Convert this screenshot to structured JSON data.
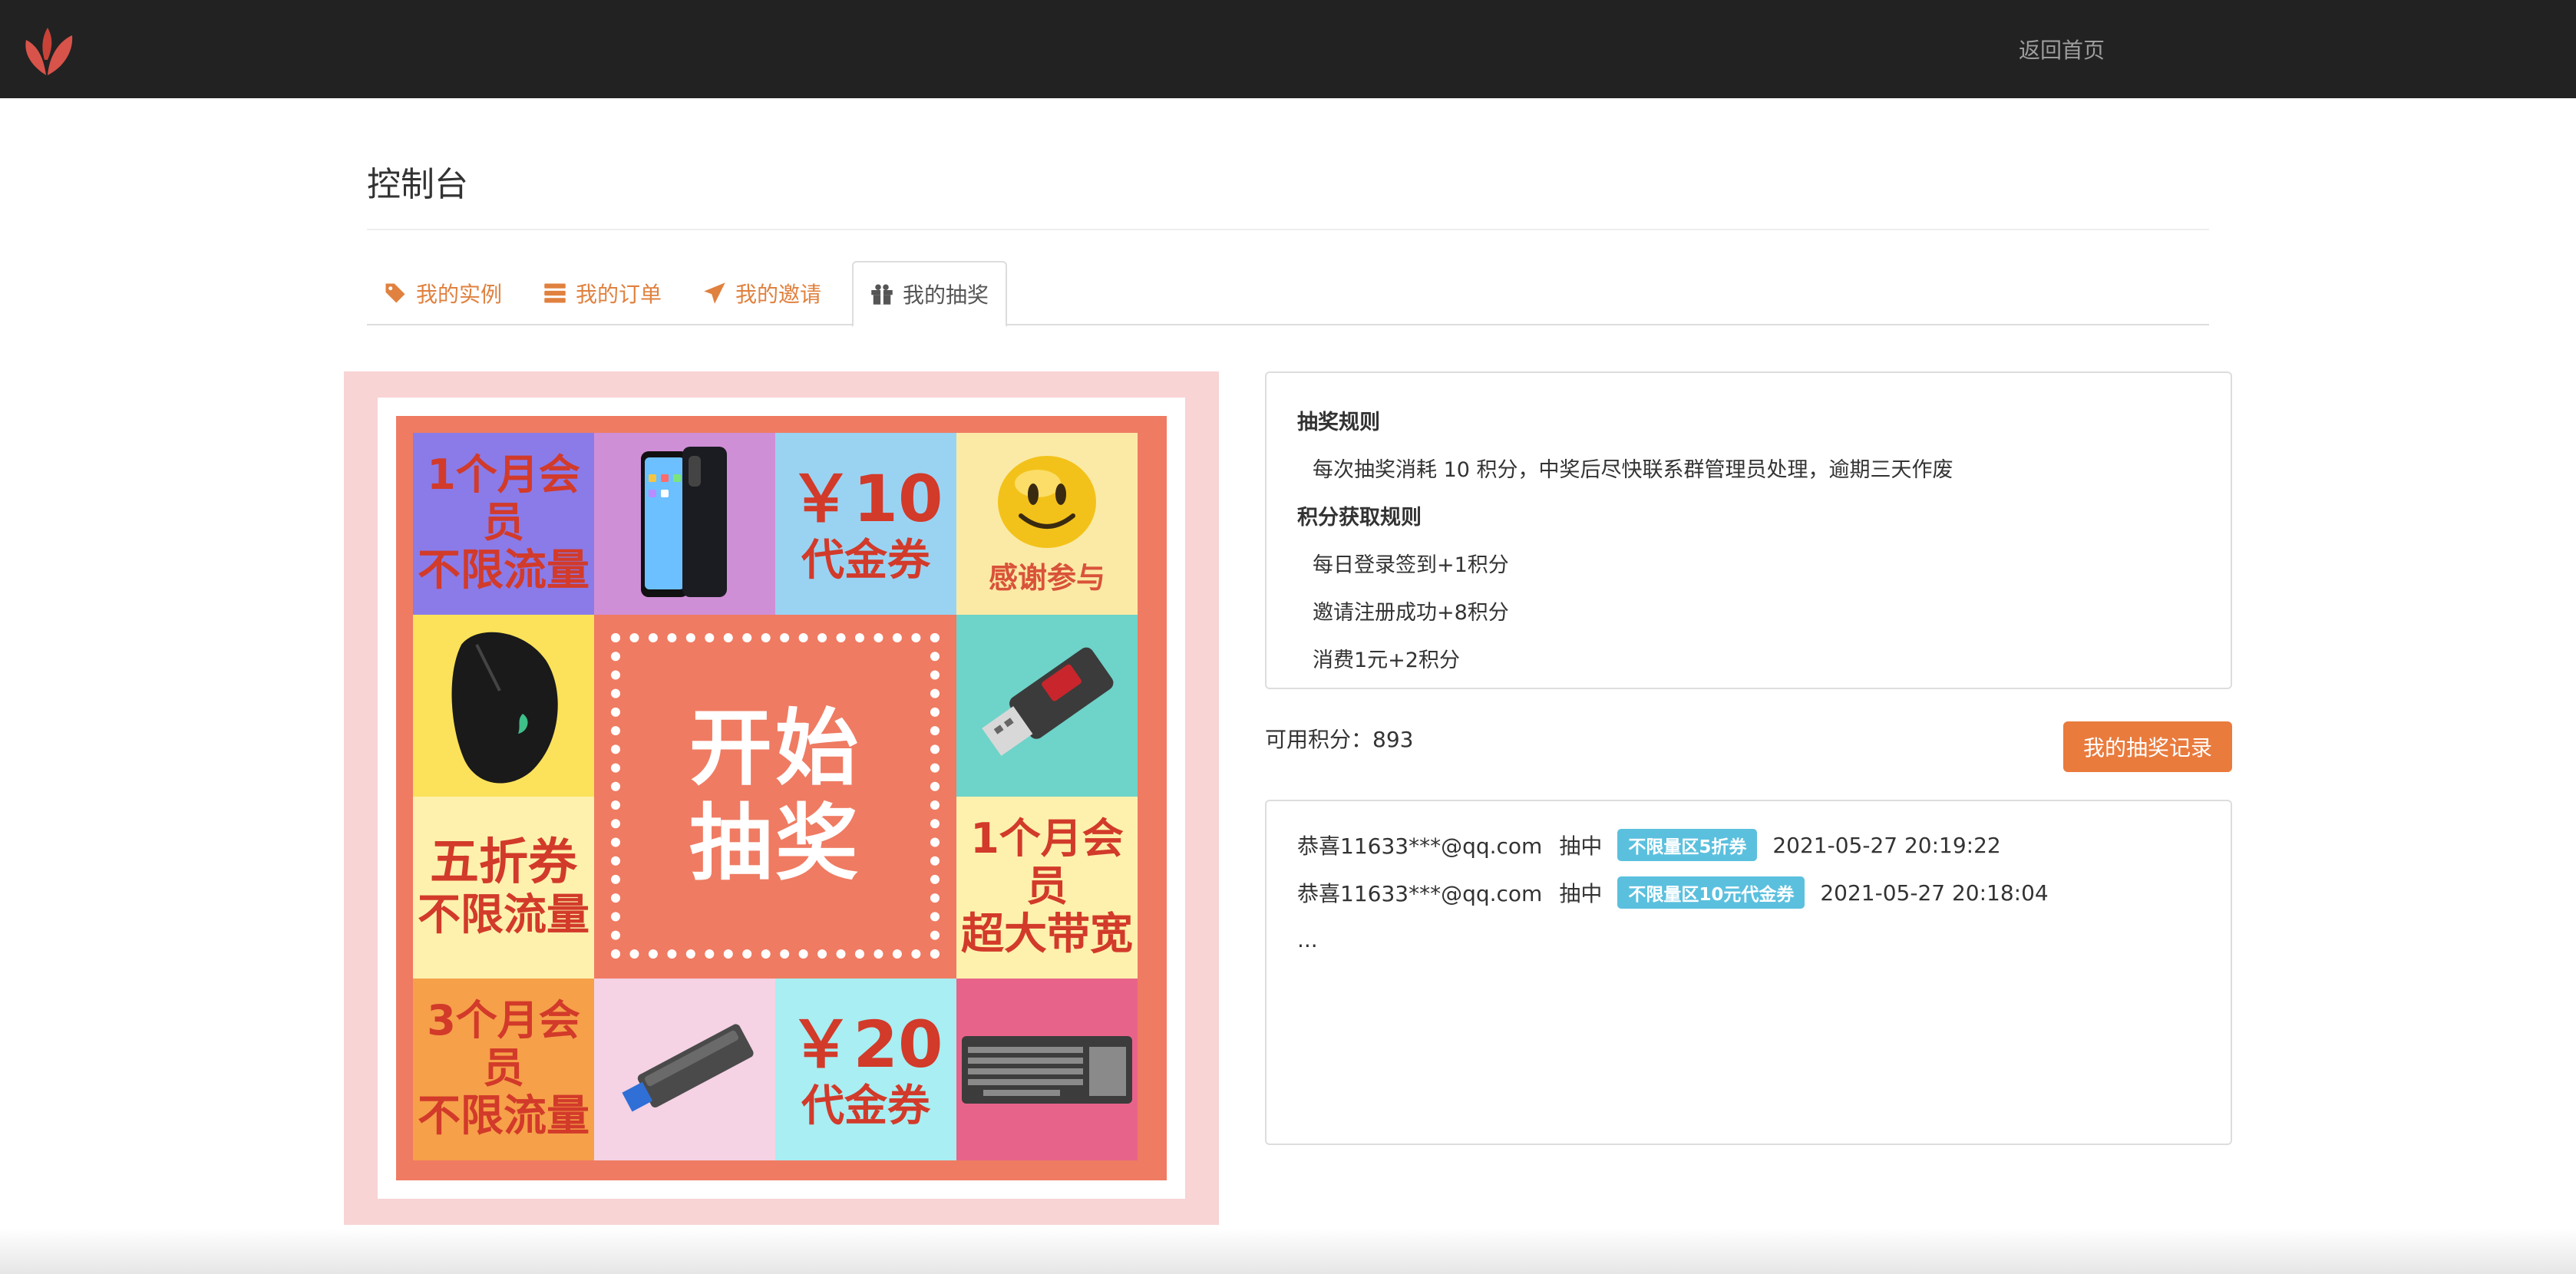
{
  "nav": {
    "home_link": "返回首页"
  },
  "page": {
    "title": "控制台"
  },
  "tabs": [
    {
      "label": "我的实例",
      "icon": "tag-icon"
    },
    {
      "label": "我的订单",
      "icon": "server-icon"
    },
    {
      "label": "我的邀请",
      "icon": "send-icon"
    },
    {
      "label": "我的抽奖",
      "icon": "gift-icon",
      "active": true
    }
  ],
  "board": {
    "start_line1": "开始",
    "start_line2": "抽奖",
    "prizes": [
      {
        "l1": "1个月会员",
        "l2": "不限流量",
        "bg": "#8a7be8"
      },
      {
        "image": "phone",
        "bg": "#cf8fd6"
      },
      {
        "l1": "￥10",
        "l2": "代金券",
        "bg": "#9ad3f2"
      },
      {
        "image": "smiley",
        "l2": "感谢参与",
        "bg": "#fbeaa6"
      },
      {
        "image": "usb-drive-red",
        "bg": "#6ed3c9"
      },
      {
        "l1": "1个月会员",
        "l2": "超大带宽",
        "bg": "#fdf1ad"
      },
      {
        "image": "keyboard",
        "bg": "#e8638a"
      },
      {
        "l1": "￥20",
        "l2": "代金券",
        "bg": "#a8eef2"
      },
      {
        "image": "ssd",
        "bg": "#f5d2e4"
      },
      {
        "l1": "3个月会员",
        "l2": "不限流量",
        "bg": "#f6a04a"
      },
      {
        "l1": "五折券",
        "l2": "不限流量",
        "bg": "#fdf1ad"
      },
      {
        "image": "mouse",
        "bg": "#fbe25a"
      }
    ]
  },
  "rules": {
    "title": "抽奖规则",
    "desc": "每次抽奖消耗 10 积分，中奖后尽快联系群管理员处理，逾期三天作废",
    "points_title": "积分获取规则",
    "points_items": [
      "每日登录签到+1积分",
      "邀请注册成功+8积分",
      "消费1元+2积分"
    ]
  },
  "points": {
    "label": "可用积分：",
    "value": "893"
  },
  "record_button": "我的抽奖记录",
  "records": [
    {
      "user": "恭喜11633***@qq.com",
      "verb": "抽中",
      "prize": "不限量区5折券",
      "time": "2021-05-27 20:19:22"
    },
    {
      "user": "恭喜11633***@qq.com",
      "verb": "抽中",
      "prize": "不限量区10元代金券",
      "time": "2021-05-27 20:18:04"
    }
  ],
  "records_more": "...",
  "colors": {
    "accent": "#e97b3d",
    "nav_bg": "#222222",
    "badge": "#5bc0de"
  }
}
